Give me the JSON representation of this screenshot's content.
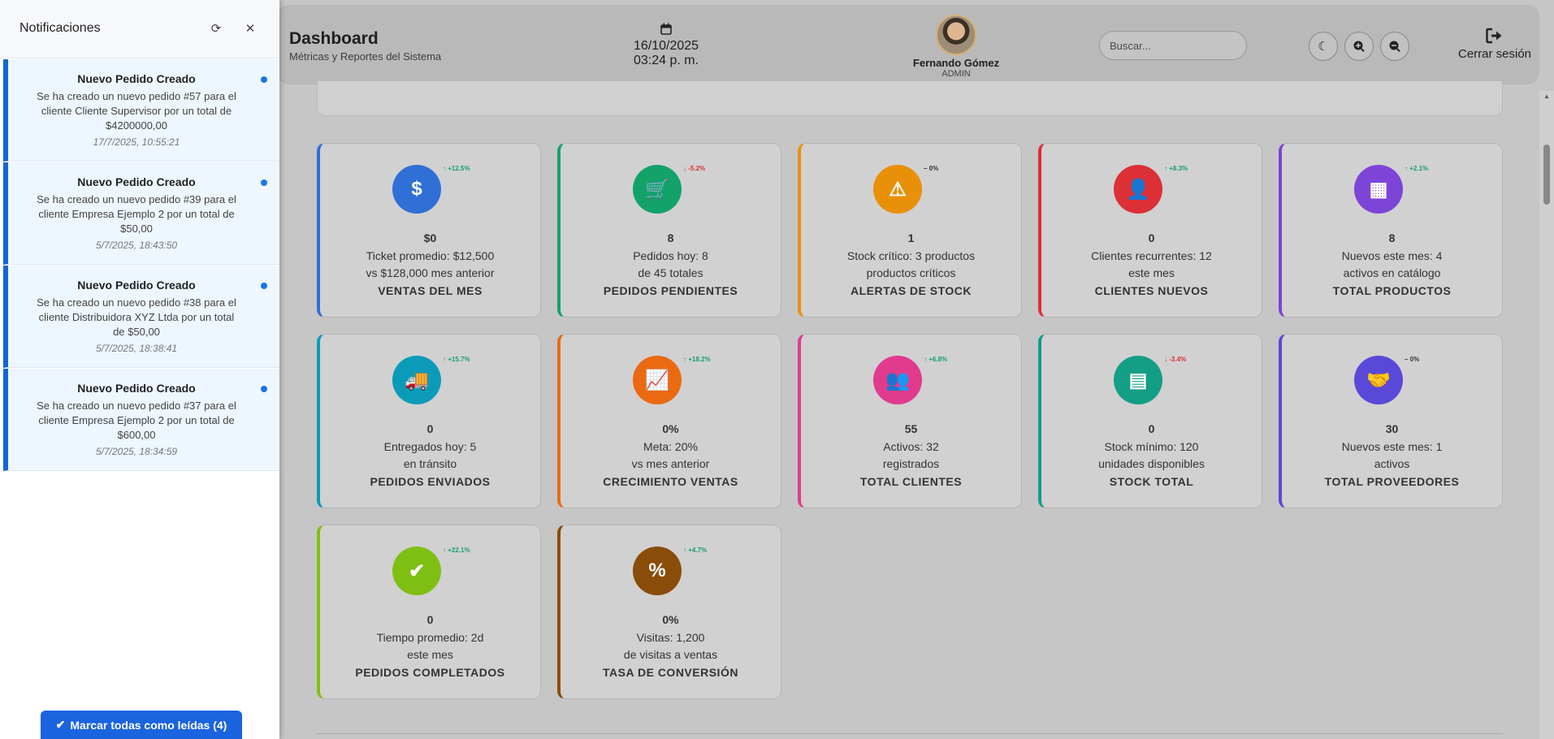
{
  "header": {
    "title": "Dashboard",
    "subtitle": "Métricas y Reportes del Sistema",
    "date": "16/10/2025",
    "time": "03:24 p. m.",
    "user_name": "Fernando Gómez",
    "user_role": "ADMIN",
    "search_placeholder": "Buscar...",
    "logout_label": "Cerrar sesión"
  },
  "cards": [
    {
      "value": "$0",
      "line1": "Ticket promedio: $12,500",
      "line2": "vs $128,000 mes anterior",
      "label": "VENTAS DEL MES",
      "trend": "+12.5%",
      "trend_dir": "up",
      "color": "#2f6fd6",
      "icon": "dollar-icon",
      "glyph": "$"
    },
    {
      "value": "8",
      "line1": "Pedidos hoy: 8",
      "line2": "de 45 totales",
      "label": "PEDIDOS PENDIENTES",
      "trend": "-5.2%",
      "trend_dir": "down",
      "color": "#13a26a",
      "icon": "cart-icon",
      "glyph": "🛒"
    },
    {
      "value": "1",
      "line1": "Stock crítico: 3 productos",
      "line2": "productos críticos",
      "label": "ALERTAS DE STOCK",
      "trend": "0%",
      "trend_dir": "flat",
      "color": "#e89008",
      "icon": "warning-icon",
      "glyph": "⚠"
    },
    {
      "value": "0",
      "line1": "Clientes recurrentes: 12",
      "line2": "este mes",
      "label": "CLIENTES NUEVOS",
      "trend": "+8.3%",
      "trend_dir": "up",
      "color": "#dc2f36",
      "icon": "user-plus-icon",
      "glyph": "👤"
    },
    {
      "value": "8",
      "line1": "Nuevos este mes: 4",
      "line2": "activos en catálogo",
      "label": "TOTAL PRODUCTOS",
      "trend": "+2.1%",
      "trend_dir": "up",
      "color": "#7d44d8",
      "icon": "boxes-icon",
      "glyph": "▦"
    },
    {
      "value": "0",
      "line1": "Entregados hoy: 5",
      "line2": "en tránsito",
      "label": "PEDIDOS ENVIADOS",
      "trend": "+15.7%",
      "trend_dir": "up",
      "color": "#0b9bb9",
      "icon": "truck-icon",
      "glyph": "🚚"
    },
    {
      "value": "0%",
      "line1": "Meta: 20%",
      "line2": "vs mes anterior",
      "label": "CRECIMIENTO VENTAS",
      "trend": "+18.2%",
      "trend_dir": "up",
      "color": "#ea6a12",
      "icon": "chart-line-icon",
      "glyph": "📈"
    },
    {
      "value": "55",
      "line1": "Activos: 32",
      "line2": "registrados",
      "label": "TOTAL CLIENTES",
      "trend": "+6.8%",
      "trend_dir": "up",
      "color": "#e03b8d",
      "icon": "users-icon",
      "glyph": "👥"
    },
    {
      "value": "0",
      "line1": "Stock mínimo: 120",
      "line2": "unidades disponibles",
      "label": "STOCK TOTAL",
      "trend": "-3.4%",
      "trend_dir": "down",
      "color": "#139e86",
      "icon": "warehouse-icon",
      "glyph": "▤"
    },
    {
      "value": "30",
      "line1": "Nuevos este mes: 1",
      "line2": "activos",
      "label": "TOTAL PROVEEDORES",
      "trend": "0%",
      "trend_dir": "flat",
      "color": "#5a49d8",
      "icon": "handshake-icon",
      "glyph": "🤝"
    },
    {
      "value": "0",
      "line1": "Tiempo promedio: 2d",
      "line2": "este mes",
      "label": "PEDIDOS COMPLETADOS",
      "trend": "+22.1%",
      "trend_dir": "up",
      "color": "#7fbf14",
      "icon": "check-circle-icon",
      "glyph": "✔"
    },
    {
      "value": "0%",
      "line1": "Visitas: 1,200",
      "line2": "de visitas a ventas",
      "label": "TASA DE CONVERSIÓN",
      "trend": "+4.7%",
      "trend_dir": "up",
      "color": "#8a4d09",
      "icon": "percent-icon",
      "glyph": "%"
    }
  ],
  "notifications": {
    "title": "Notificaciones",
    "items": [
      {
        "title": "Nuevo Pedido Creado",
        "body": "Se ha creado un nuevo pedido #57 para el cliente Cliente Supervisor por un total de $4200000,00",
        "date": "17/7/2025, 10:55:21"
      },
      {
        "title": "Nuevo Pedido Creado",
        "body": "Se ha creado un nuevo pedido #39 para el cliente Empresa Ejemplo 2 por un total de $50,00",
        "date": "5/7/2025, 18:43:50"
      },
      {
        "title": "Nuevo Pedido Creado",
        "body": "Se ha creado un nuevo pedido #38 para el cliente Distribuidora XYZ Ltda por un total de $50,00",
        "date": "5/7/2025, 18:38:41"
      },
      {
        "title": "Nuevo Pedido Creado",
        "body": "Se ha creado un nuevo pedido #37 para el cliente Empresa Ejemplo 2 por un total de $600,00",
        "date": "5/7/2025, 18:34:59"
      }
    ],
    "mark_all_label": "Marcar todas como leídas (4)"
  },
  "colors": {
    "accent": "#1a64e0",
    "trend_up": "#13a26a",
    "trend_down": "#dc2f36"
  }
}
